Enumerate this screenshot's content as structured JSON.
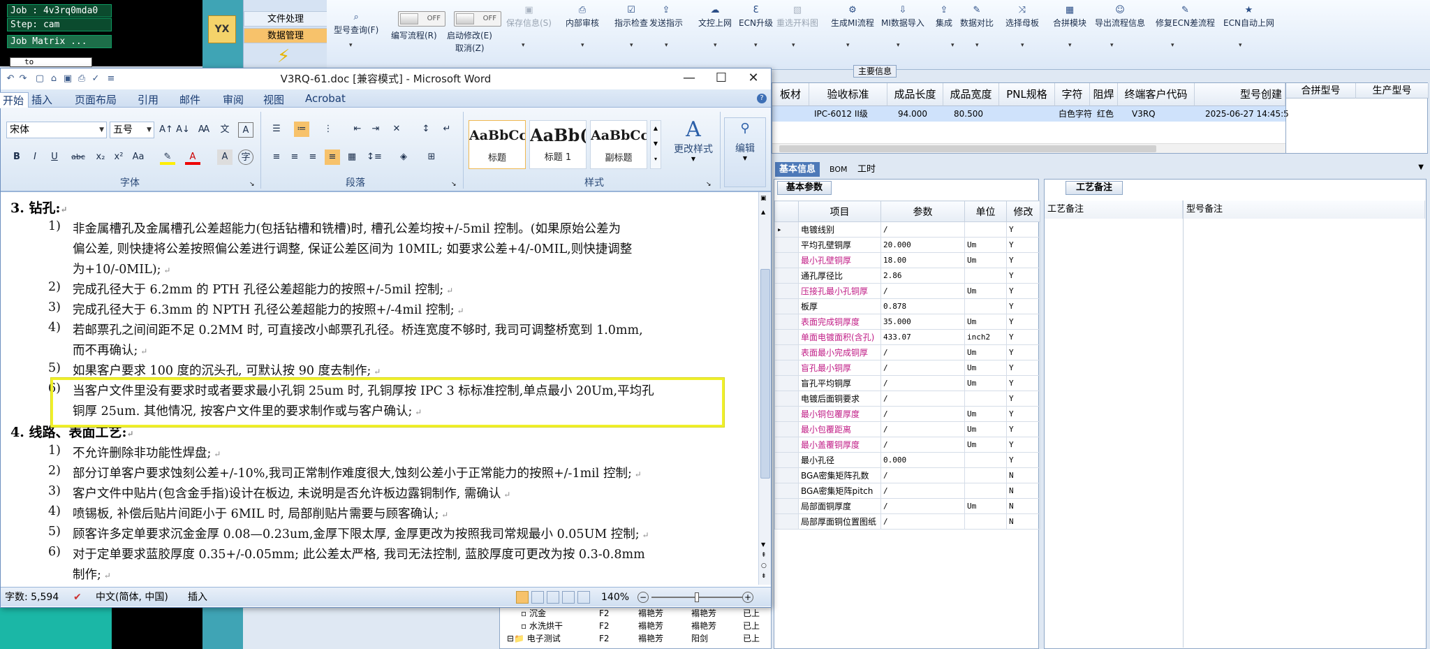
{
  "terminal": {
    "lines": [
      "Job : 4v3rq0mda0",
      "Step: cam",
      "Job Matrix ..."
    ],
    "input_value": "to"
  },
  "side_panel": {
    "tabs": [
      "文件处理",
      "数据管理"
    ],
    "app_label": "YX"
  },
  "app_ribbon": {
    "items": [
      {
        "label": "型号查询(F)",
        "icon": "search-icon",
        "disabled": false
      },
      {
        "label": "编写流程(R)",
        "icon": "toggle",
        "disabled": false,
        "toggle": "OFF"
      },
      {
        "label": "启动修改(E)",
        "icon": "toggle",
        "disabled": false,
        "toggle": "OFF",
        "sub": "取消(Z)"
      },
      {
        "label": "保存信息(S)",
        "icon": "save-icon",
        "disabled": true
      },
      {
        "label": "内部审核",
        "icon": "print-icon",
        "disabled": false
      },
      {
        "label": "指示检查",
        "icon": "check-icon",
        "disabled": false
      },
      {
        "label": "发送指示",
        "icon": "upload-icon",
        "disabled": false
      },
      {
        "label": "文控上网",
        "icon": "cloud-icon",
        "disabled": false
      },
      {
        "label": "ECN升级",
        "icon": "ecn-icon",
        "disabled": false
      },
      {
        "label": "重选开料图",
        "icon": "image-icon",
        "disabled": true
      },
      {
        "label": "生成MI流程",
        "icon": "gears-icon",
        "disabled": false
      },
      {
        "label": "MI数据导入",
        "icon": "import-icon",
        "disabled": false
      },
      {
        "label": "集成",
        "icon": "upload-icon",
        "disabled": false
      },
      {
        "label": "数据对比",
        "icon": "wrench-icon",
        "disabled": false
      },
      {
        "label": "选择母板",
        "icon": "shuffle-icon",
        "disabled": false
      },
      {
        "label": "合拼模块",
        "icon": "grid-icon",
        "disabled": false
      },
      {
        "label": "导出流程信息",
        "icon": "smile-icon",
        "disabled": false
      },
      {
        "label": "修复ECN差流程",
        "icon": "wrench-icon",
        "disabled": false
      },
      {
        "label": "ECN自动上网",
        "icon": "star-icon",
        "disabled": false
      }
    ]
  },
  "main_info": {
    "label": "主要信息",
    "columns": [
      "板材",
      "验收标准",
      "成品长度",
      "成品宽度",
      "PNL规格",
      "字符",
      "阻焊",
      "终端客户代码",
      "型号创建"
    ],
    "row": [
      "IPC-6012 II级",
      "94.000",
      "80.500",
      "白色字符",
      "红色",
      "V3RQ",
      "2025-06-27 14:45:5"
    ],
    "merge_columns": [
      "合拼型号",
      "生产型号"
    ]
  },
  "info_tabs": [
    "基本信息",
    "BOM",
    "工时"
  ],
  "params": {
    "title": "基本参数",
    "headers": [
      "项目",
      "参数",
      "单位",
      "修改"
    ],
    "rows": [
      {
        "name": "电镀线别",
        "value": "/",
        "unit": "",
        "flag": "Y",
        "pink": false
      },
      {
        "name": "平均孔壁铜厚",
        "value": "20.000",
        "unit": "Um",
        "flag": "Y",
        "pink": false
      },
      {
        "name": "最小孔壁铜厚",
        "value": "18.00",
        "unit": "Um",
        "flag": "Y",
        "pink": true
      },
      {
        "name": "通孔厚径比",
        "value": "2.86",
        "unit": "",
        "flag": "Y",
        "pink": false
      },
      {
        "name": "压接孔最小孔铜厚",
        "value": "/",
        "unit": "Um",
        "flag": "Y",
        "pink": true
      },
      {
        "name": "板厚",
        "value": "0.878",
        "unit": "",
        "flag": "Y",
        "pink": false
      },
      {
        "name": "表面完成铜厚度",
        "value": "35.000",
        "unit": "Um",
        "flag": "Y",
        "pink": true
      },
      {
        "name": "单面电镀面积(含孔)",
        "value": "433.07",
        "unit": "inch2",
        "flag": "Y",
        "pink": true
      },
      {
        "name": "表面最小完成铜厚",
        "value": "/",
        "unit": "Um",
        "flag": "Y",
        "pink": true
      },
      {
        "name": "盲孔最小铜厚",
        "value": "/",
        "unit": "Um",
        "flag": "Y",
        "pink": true
      },
      {
        "name": "盲孔平均铜厚",
        "value": "/",
        "unit": "Um",
        "flag": "Y",
        "pink": false
      },
      {
        "name": "电镀后面铜要求",
        "value": "/",
        "unit": "",
        "flag": "Y",
        "pink": false
      },
      {
        "name": "最小铜包覆厚度",
        "value": "/",
        "unit": "Um",
        "flag": "Y",
        "pink": true
      },
      {
        "name": "最小包覆距离",
        "value": "/",
        "unit": "Um",
        "flag": "Y",
        "pink": true
      },
      {
        "name": "最小盖覆铜厚度",
        "value": "/",
        "unit": "Um",
        "flag": "Y",
        "pink": true
      },
      {
        "name": "最小孔径",
        "value": "0.000",
        "unit": "",
        "flag": "Y",
        "pink": false
      },
      {
        "name": "BGA密集矩阵孔数",
        "value": "/",
        "unit": "",
        "flag": "N",
        "pink": false
      },
      {
        "name": "BGA密集矩阵pitch",
        "value": "/",
        "unit": "",
        "flag": "N",
        "pink": false
      },
      {
        "name": "局部面铜厚度",
        "value": "/",
        "unit": "Um",
        "flag": "N",
        "pink": false
      },
      {
        "name": "局部厚面铜位置图纸",
        "value": "/",
        "unit": "",
        "flag": "N",
        "pink": false
      }
    ]
  },
  "notes": {
    "title": "工艺备注",
    "col1": "工艺备注",
    "col2": "型号备注"
  },
  "bg_tree": {
    "rows": [
      {
        "name": "沉金",
        "c1": "F2",
        "c2": "褟艳芳",
        "c3": "褟艳芳",
        "c4": "已上"
      },
      {
        "name": "水洗烘干",
        "c1": "F2",
        "c2": "褟艳芳",
        "c3": "褟艳芳",
        "c4": "已上"
      },
      {
        "name": "电子测试",
        "c1": "F2",
        "c2": "褟艳芳",
        "c3": "阳剑",
        "c4": "已上"
      }
    ]
  },
  "word": {
    "title": "V3RQ-61.doc [兼容模式] - Microsoft Word",
    "tabs": [
      "开始",
      "插入",
      "页面布局",
      "引用",
      "邮件",
      "审阅",
      "视图",
      "Acrobat"
    ],
    "font_name": "宋体",
    "font_size": "五号",
    "groups": [
      "字体",
      "段落",
      "样式",
      "编辑"
    ],
    "styles": [
      {
        "sample": "AaBbCc",
        "name": "标题"
      },
      {
        "sample": "AaBb(",
        "name": "标题 1"
      },
      {
        "sample": "AaBbCc",
        "name": "副标题"
      }
    ],
    "change_styles": "更改样式",
    "edit_label": "编辑",
    "status": {
      "word_count": "字数: 5,594",
      "language": "中文(简体, 中国)",
      "mode": "插入",
      "zoom": "140%"
    },
    "doc": {
      "h3": "3.   钻孔:",
      "h4": "4.   线路、表面工艺:",
      "section3": [
        {
          "n": "1)",
          "lines": [
            "非金属槽孔及金属槽孔公差超能力(包括钻槽和铣槽)时, 槽孔公差均按+/-5mil 控制。(如果原始公差为",
            "偏公差, 则快捷将公差按照偏公差进行调整, 保证公差区间为 10MIL; 如要求公差+4/-0MIL,则快捷调整",
            "为+10/-0MIL);"
          ]
        },
        {
          "n": "2)",
          "lines": [
            "完成孔径大于 6.2mm 的 PTH 孔径公差超能力的按照+/-5mil 控制;"
          ]
        },
        {
          "n": "3)",
          "lines": [
            "完成孔径大于 6.3mm 的 NPTH 孔径公差超能力的按照+/-4mil 控制;"
          ]
        },
        {
          "n": "4)",
          "lines": [
            "若邮票孔之间间距不足 0.2MM 时, 可直接改小邮票孔孔径。桥连宽度不够时, 我司可调整桥宽到 1.0mm,",
            "而不再确认;"
          ]
        },
        {
          "n": "5)",
          "lines": [
            "如果客户要求 100 度的沉头孔, 可默认按 90 度去制作;"
          ]
        },
        {
          "n": "6)",
          "lines": [
            "当客户文件里没有要求时或者要求最小孔铜 25um 时, 孔铜厚按 IPC 3 标标准控制,单点最小 20Um,平均孔",
            "铜厚 25um. 其他情况, 按客户文件里的要求制作或与客户确认;"
          ]
        }
      ],
      "section4": [
        {
          "n": "1)",
          "lines": [
            "不允许删除非功能性焊盘;"
          ]
        },
        {
          "n": "2)",
          "lines": [
            "部分订单客户要求蚀刻公差+/-10%,我司正常制作难度很大,蚀刻公差小于正常能力的按照+/-1mil 控制;"
          ]
        },
        {
          "n": "3)",
          "lines": [
            "客户文件中贴片(包含金手指)设计在板边, 未说明是否允许板边露铜制作, 需确认"
          ]
        },
        {
          "n": "4)",
          "lines": [
            "喷锡板, 补偿后贴片间距小于 6MIL 时, 局部削贴片需要与顾客确认;"
          ]
        },
        {
          "n": "5)",
          "lines": [
            "顾客许多定单要求沉金金厚 0.08—0.23um,金厚下限太厚, 金厚更改为按照我司常规最小 0.05UM 控制;"
          ]
        },
        {
          "n": "6)",
          "lines": [
            "对于定单要求蓝胶厚度 0.35+/-0.05mm; 此公差太严格, 我司无法控制, 蓝胶厚度可更改为按 0.3-0.8mm",
            "制作;"
          ]
        }
      ]
    }
  },
  "colors": {
    "highlight": "#f0f02a",
    "pink_text": "#c01c86",
    "selected_row": "#cfe2fb",
    "tab_active": "#4d79b8"
  }
}
